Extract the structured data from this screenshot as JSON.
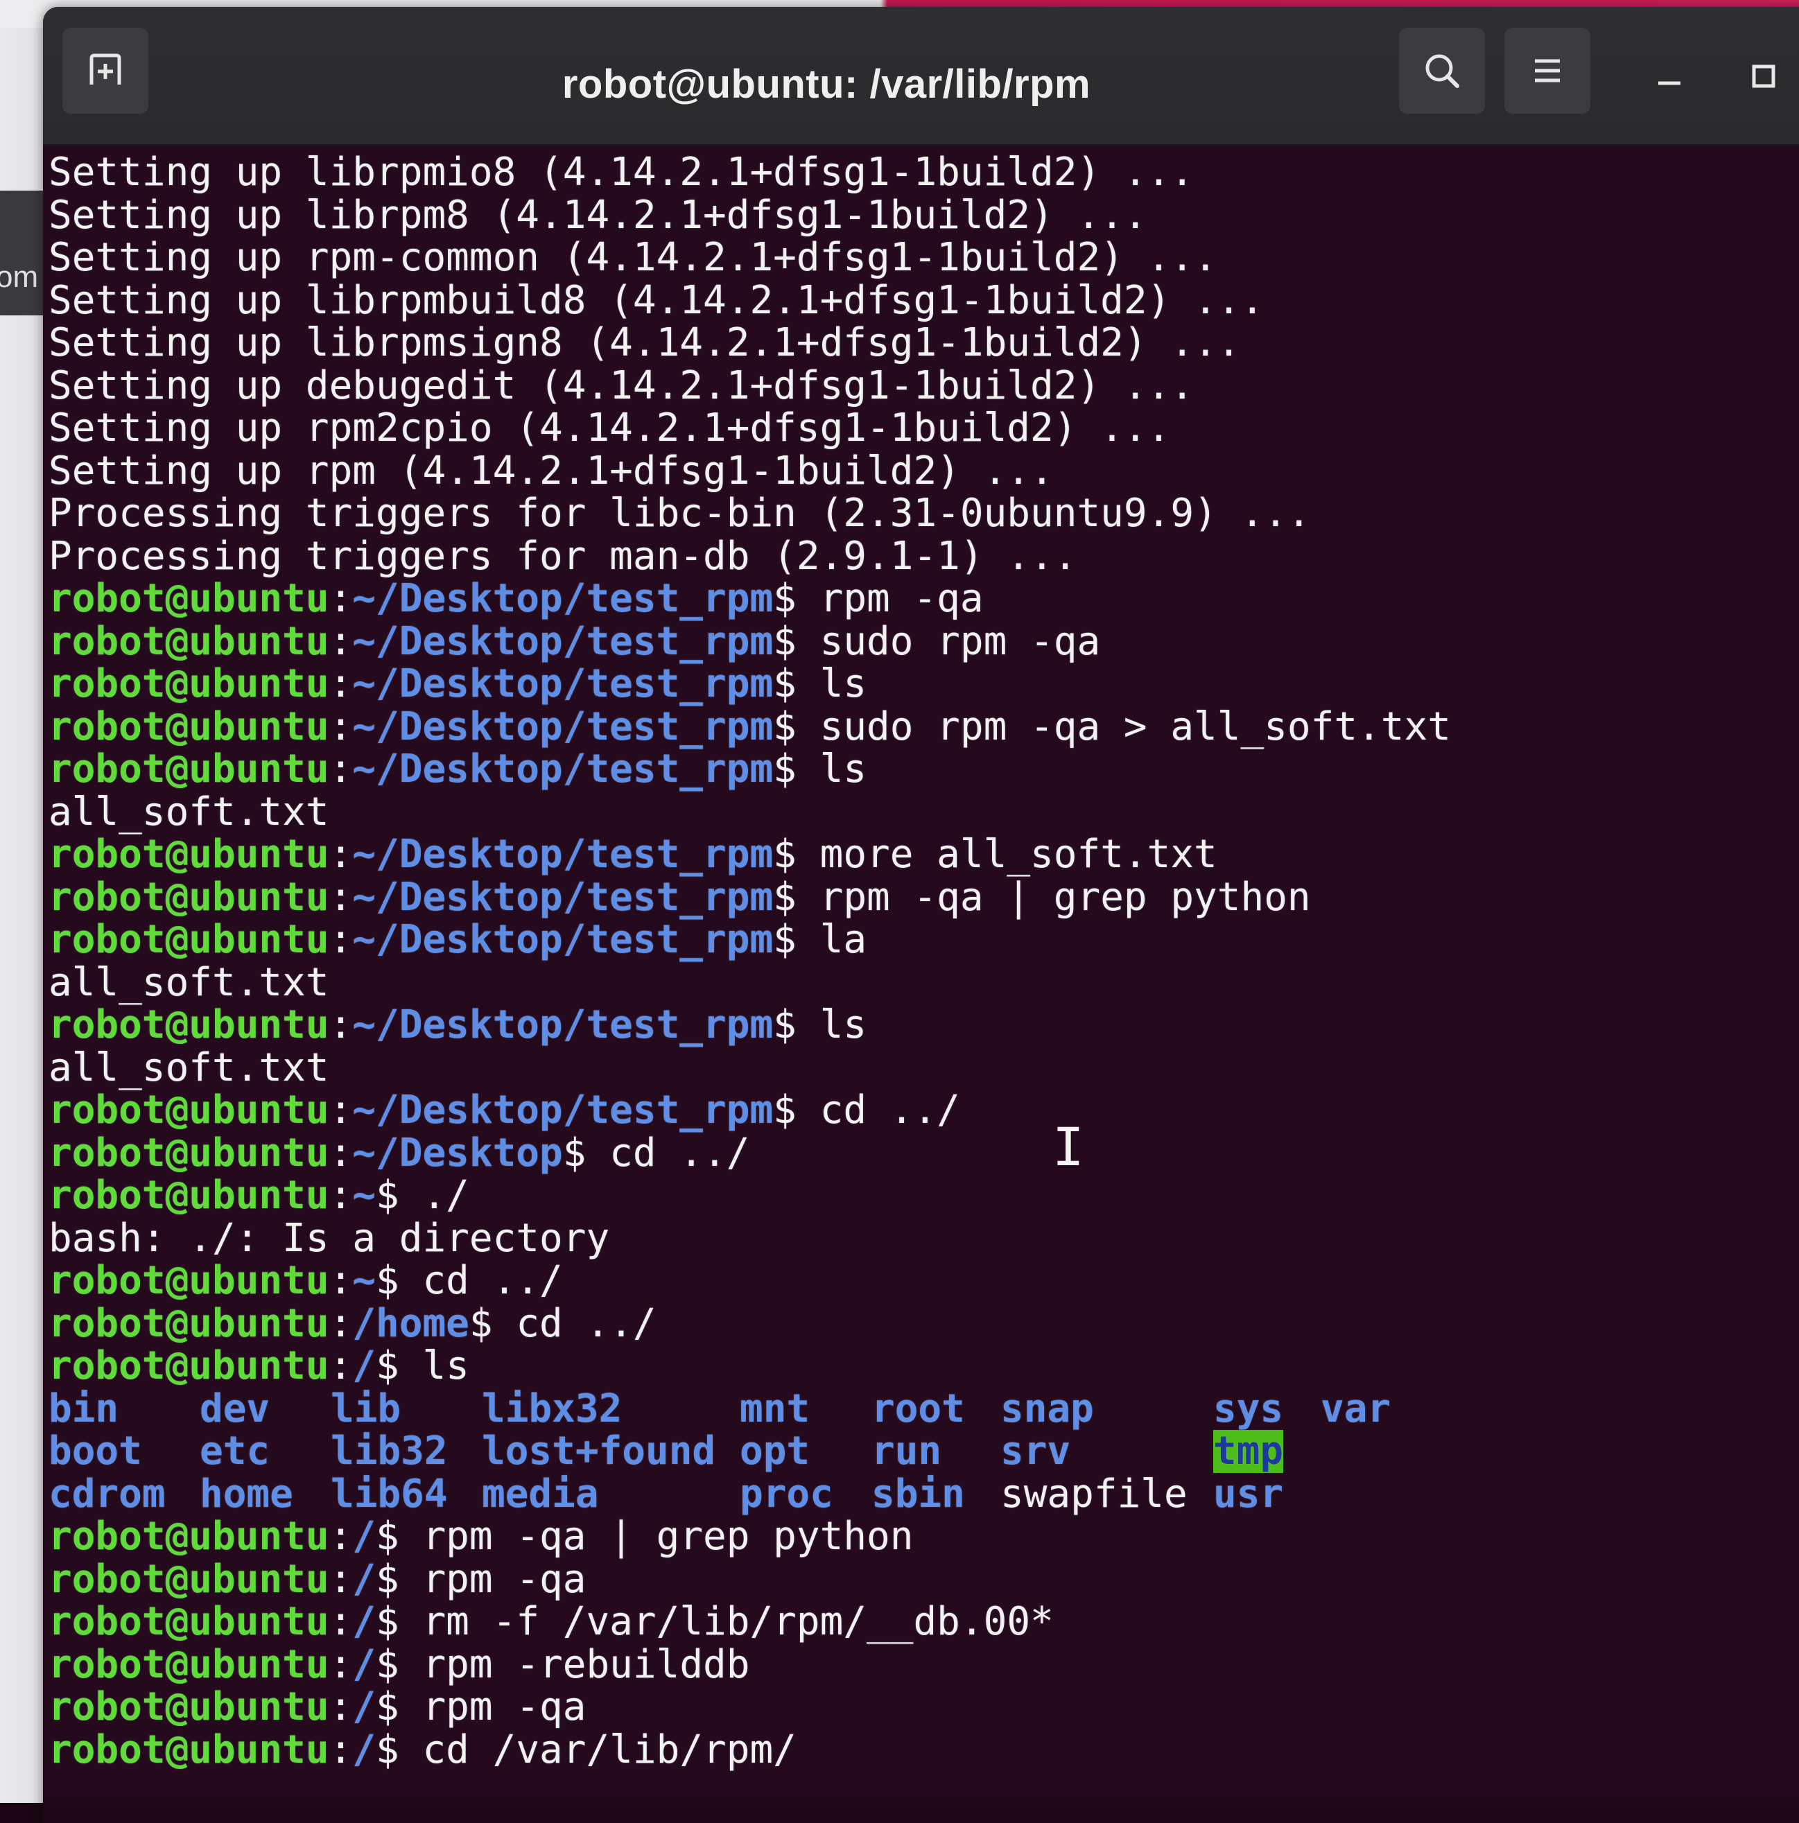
{
  "desktop": {
    "side_text": "om"
  },
  "window": {
    "title": "robot@ubuntu: /var/lib/rpm",
    "buttons": {
      "new_tab_icon": "new-tab-icon",
      "search_icon": "search-icon",
      "menu_icon": "hamburger-menu-icon",
      "minimize_icon": "minimize-icon",
      "maximize_icon": "maximize-icon"
    }
  },
  "colors": {
    "terminal_bg": "#250a1e",
    "prompt_user": "#5fdc3a",
    "prompt_path": "#5e8ee6",
    "text": "#f2f2f2",
    "tmp_highlight": "#4dbd1a"
  },
  "terminal": {
    "lines": [
      {
        "type": "out",
        "text": "Setting up librpmio8 (4.14.2.1+dfsg1-1build2) ..."
      },
      {
        "type": "out",
        "text": "Setting up librpm8 (4.14.2.1+dfsg1-1build2) ..."
      },
      {
        "type": "out",
        "text": "Setting up rpm-common (4.14.2.1+dfsg1-1build2) ..."
      },
      {
        "type": "out",
        "text": "Setting up librpmbuild8 (4.14.2.1+dfsg1-1build2) ..."
      },
      {
        "type": "out",
        "text": "Setting up librpmsign8 (4.14.2.1+dfsg1-1build2) ..."
      },
      {
        "type": "out",
        "text": "Setting up debugedit (4.14.2.1+dfsg1-1build2) ..."
      },
      {
        "type": "out",
        "text": "Setting up rpm2cpio (4.14.2.1+dfsg1-1build2) ..."
      },
      {
        "type": "out",
        "text": "Setting up rpm (4.14.2.1+dfsg1-1build2) ..."
      },
      {
        "type": "out",
        "text": "Processing triggers for libc-bin (2.31-0ubuntu9.9) ..."
      },
      {
        "type": "out",
        "text": "Processing triggers for man-db (2.9.1-1) ..."
      },
      {
        "type": "cmd",
        "user": "robot@ubuntu",
        "path": "~/Desktop/test_rpm",
        "cmd": "rpm -qa"
      },
      {
        "type": "cmd",
        "user": "robot@ubuntu",
        "path": "~/Desktop/test_rpm",
        "cmd": "sudo rpm -qa"
      },
      {
        "type": "cmd",
        "user": "robot@ubuntu",
        "path": "~/Desktop/test_rpm",
        "cmd": "ls"
      },
      {
        "type": "cmd",
        "user": "robot@ubuntu",
        "path": "~/Desktop/test_rpm",
        "cmd": "sudo rpm -qa > all_soft.txt"
      },
      {
        "type": "cmd",
        "user": "robot@ubuntu",
        "path": "~/Desktop/test_rpm",
        "cmd": "ls"
      },
      {
        "type": "out",
        "text": "all_soft.txt"
      },
      {
        "type": "cmd",
        "user": "robot@ubuntu",
        "path": "~/Desktop/test_rpm",
        "cmd": "more all_soft.txt"
      },
      {
        "type": "cmd",
        "user": "robot@ubuntu",
        "path": "~/Desktop/test_rpm",
        "cmd": "rpm -qa | grep python"
      },
      {
        "type": "cmd",
        "user": "robot@ubuntu",
        "path": "~/Desktop/test_rpm",
        "cmd": "la"
      },
      {
        "type": "out",
        "text": "all_soft.txt"
      },
      {
        "type": "cmd",
        "user": "robot@ubuntu",
        "path": "~/Desktop/test_rpm",
        "cmd": "ls"
      },
      {
        "type": "out",
        "text": "all_soft.txt"
      },
      {
        "type": "cmd",
        "user": "robot@ubuntu",
        "path": "~/Desktop/test_rpm",
        "cmd": "cd ../"
      },
      {
        "type": "cmd",
        "user": "robot@ubuntu",
        "path": "~/Desktop",
        "cmd": "cd ../"
      },
      {
        "type": "cmd",
        "user": "robot@ubuntu",
        "path": "~",
        "cmd": "./"
      },
      {
        "type": "out",
        "text": "bash: ./: Is a directory"
      },
      {
        "type": "cmd",
        "user": "robot@ubuntu",
        "path": "~",
        "cmd": "cd ../"
      },
      {
        "type": "cmd",
        "user": "robot@ubuntu",
        "path": "/home",
        "cmd": "cd ../"
      },
      {
        "type": "cmd",
        "user": "robot@ubuntu",
        "path": "/",
        "cmd": "ls"
      },
      {
        "type": "ls",
        "row": 0
      },
      {
        "type": "ls",
        "row": 1
      },
      {
        "type": "ls",
        "row": 2
      },
      {
        "type": "cmd",
        "user": "robot@ubuntu",
        "path": "/",
        "cmd": "rpm -qa | grep python"
      },
      {
        "type": "cmd",
        "user": "robot@ubuntu",
        "path": "/",
        "cmd": "rpm -qa"
      },
      {
        "type": "cmd",
        "user": "robot@ubuntu",
        "path": "/",
        "cmd": "rm -f /var/lib/rpm/__db.00*"
      },
      {
        "type": "cmd",
        "user": "robot@ubuntu",
        "path": "/",
        "cmd": "rpm -rebuilddb"
      },
      {
        "type": "cmd",
        "user": "robot@ubuntu",
        "path": "/",
        "cmd": "rpm -qa"
      },
      {
        "type": "cmd",
        "user": "robot@ubuntu",
        "path": "/",
        "cmd": "cd /var/lib/rpm/"
      }
    ],
    "ls_rows": [
      [
        {
          "name": "bin",
          "kind": "dir"
        },
        {
          "name": "dev",
          "kind": "dir"
        },
        {
          "name": "lib",
          "kind": "dir"
        },
        {
          "name": "libx32",
          "kind": "dir"
        },
        {
          "name": "mnt",
          "kind": "dir"
        },
        {
          "name": "root",
          "kind": "dir"
        },
        {
          "name": "snap",
          "kind": "dir"
        },
        {
          "name": "sys",
          "kind": "dir"
        },
        {
          "name": "var",
          "kind": "dir"
        }
      ],
      [
        {
          "name": "boot",
          "kind": "dir"
        },
        {
          "name": "etc",
          "kind": "dir"
        },
        {
          "name": "lib32",
          "kind": "dir"
        },
        {
          "name": "lost+found",
          "kind": "dir"
        },
        {
          "name": "opt",
          "kind": "dir"
        },
        {
          "name": "run",
          "kind": "dir"
        },
        {
          "name": "srv",
          "kind": "dir"
        },
        {
          "name": "tmp",
          "kind": "tmp"
        }
      ],
      [
        {
          "name": "cdrom",
          "kind": "dir"
        },
        {
          "name": "home",
          "kind": "dir"
        },
        {
          "name": "lib64",
          "kind": "dir"
        },
        {
          "name": "media",
          "kind": "dir"
        },
        {
          "name": "proc",
          "kind": "dir"
        },
        {
          "name": "sbin",
          "kind": "dir"
        },
        {
          "name": "swapfile",
          "kind": "file"
        },
        {
          "name": "usr",
          "kind": "dir"
        }
      ]
    ]
  }
}
